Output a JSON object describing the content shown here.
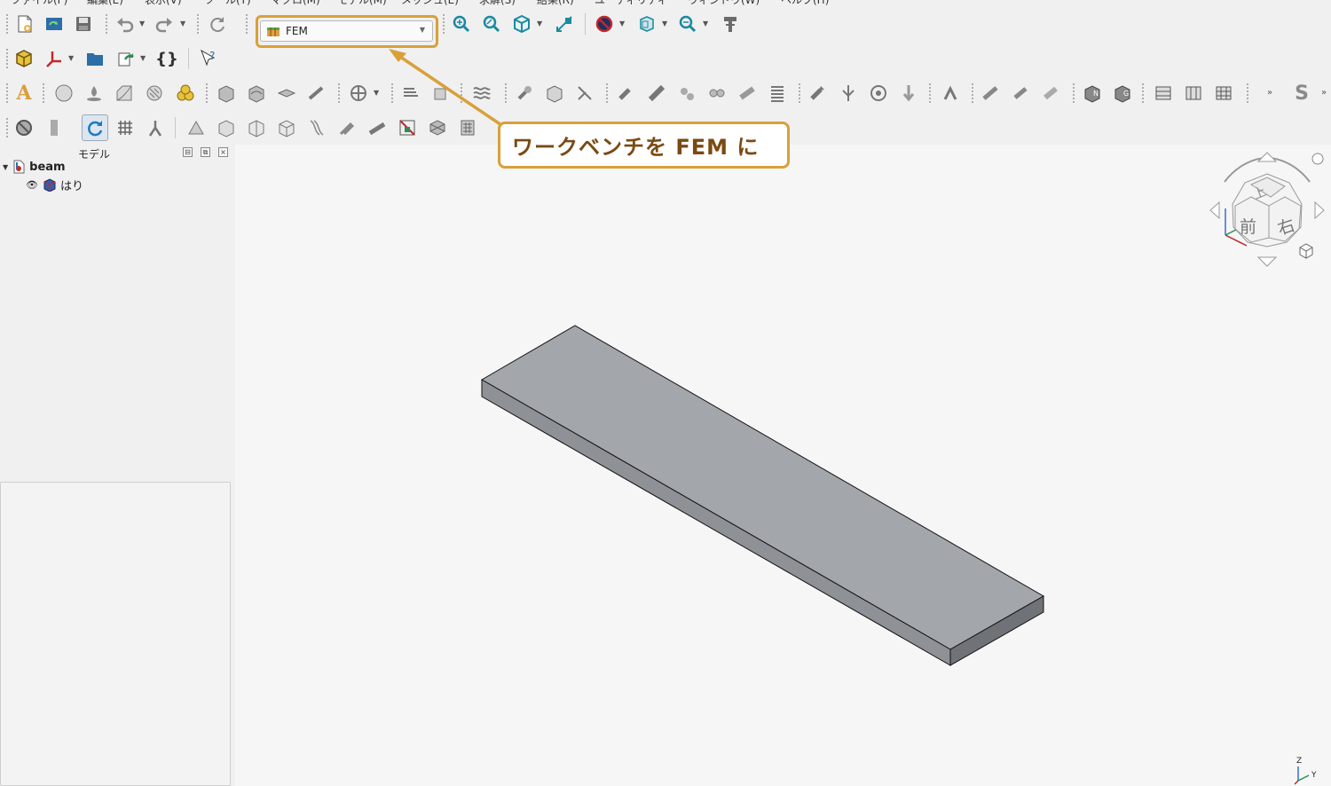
{
  "menubar": {
    "items": [
      "ファイル(F)",
      "編集(E)",
      "表示(V)",
      "ツール(T)",
      "マクロ(M)",
      "モデル(M)",
      "メッシュ(E)",
      "求解(S)",
      "結果(R)",
      "ユーティリティ",
      "ウィンドウ(W)",
      "ヘルプ(H)"
    ]
  },
  "workbench": {
    "selected": "FEM"
  },
  "tree": {
    "title": "モデル",
    "document": "beam",
    "items": [
      {
        "label": "はり"
      }
    ]
  },
  "callout": {
    "text": "ワークベンチを FEM に"
  },
  "navcube": {
    "top": "上",
    "front": "前",
    "right": "右"
  },
  "axis": {
    "z": "Z",
    "y": "Y"
  },
  "colors": {
    "accent": "#d9a03a",
    "callout_text": "#7a4a12",
    "beam_top": "#a3a6ab",
    "beam_front": "#8e9196",
    "beam_side": "#6f7277"
  }
}
